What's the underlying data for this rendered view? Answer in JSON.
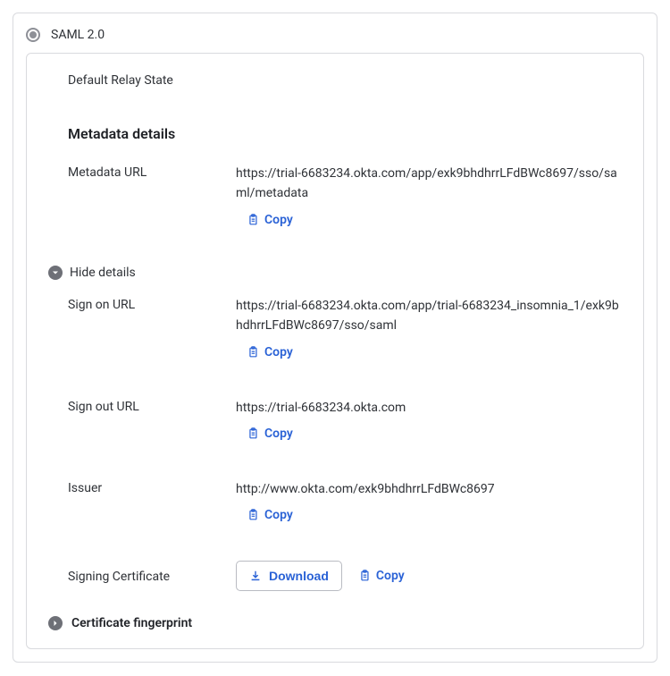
{
  "signOn": {
    "method_label": "SAML 2.0",
    "relay_label": "Default Relay State",
    "metadata_section_title": "Metadata details",
    "hide_details_label": "Hide details",
    "fields": {
      "metadata_url": {
        "label": "Metadata URL",
        "value": "https://trial-6683234.okta.com/app/exk9bhdhrrLFdBWc8697/sso/saml/metadata"
      },
      "sign_on_url": {
        "label": "Sign on URL",
        "value": "https://trial-6683234.okta.com/app/trial-6683234_insomnia_1/exk9bhdhrrLFdBWc8697/sso/saml"
      },
      "sign_out_url": {
        "label": "Sign out URL",
        "value": "https://trial-6683234.okta.com"
      },
      "issuer": {
        "label": "Issuer",
        "value": "http://www.okta.com/exk9bhdhrrLFdBWc8697"
      },
      "signing_certificate": {
        "label": "Signing Certificate"
      }
    },
    "actions": {
      "copy_label": "Copy",
      "download_label": "Download"
    },
    "fingerprint_label": "Certificate fingerprint"
  }
}
